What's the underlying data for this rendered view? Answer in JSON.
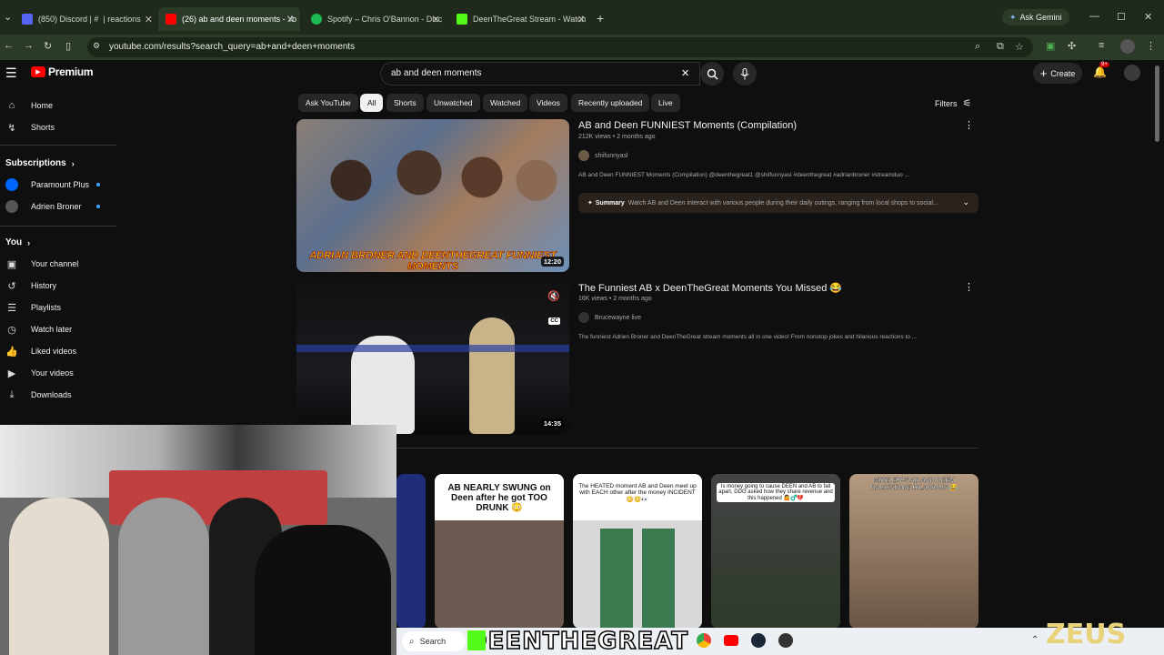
{
  "browser": {
    "tabs": [
      {
        "label": "(850) Discord | # ​ | reactions",
        "color": "#5865f2"
      },
      {
        "label": "(26) ab and deen moments - Yo",
        "color": "#ff0000"
      },
      {
        "label": "Spotify – Chris O'Bannon - Disc",
        "color": "#1db954"
      },
      {
        "label": "DeenTheGreat Stream - Watch",
        "color": "#53fc18"
      }
    ],
    "ask_gemini": "Ask Gemini",
    "url": "youtube.com/results?search_query=ab+and+deen+moments"
  },
  "masthead": {
    "logo": "Premium",
    "search_value": "ab and deen moments",
    "create_label": "Create",
    "notif_count": "9+"
  },
  "sidebar": {
    "top": [
      {
        "label": "Home",
        "icon": "home-icon"
      },
      {
        "label": "Shorts",
        "icon": "shorts-icon"
      }
    ],
    "subs_title": "Subscriptions",
    "subs": [
      {
        "label": "Paramount Plus"
      },
      {
        "label": "Adrien Broner"
      }
    ],
    "you_title": "You",
    "you": [
      {
        "label": "Your channel",
        "icon": "channel-icon"
      },
      {
        "label": "History",
        "icon": "history-icon"
      },
      {
        "label": "Playlists",
        "icon": "playlists-icon"
      },
      {
        "label": "Watch later",
        "icon": "clock-icon"
      },
      {
        "label": "Liked videos",
        "icon": "thumbs-up-icon"
      },
      {
        "label": "Your videos",
        "icon": "video-icon"
      },
      {
        "label": "Downloads",
        "icon": "download-icon"
      }
    ]
  },
  "chips": [
    "Ask YouTube",
    "All",
    "Shorts",
    "Unwatched",
    "Watched",
    "Videos",
    "Recently uploaded",
    "Live"
  ],
  "filters_label": "Filters",
  "results": [
    {
      "title": "AB and Deen FUNNIEST Moments (Compilation)",
      "meta": "212K views • 2 months ago",
      "channel": "shiifunnyasl",
      "desc": "AB and Deen FUNNIEST Moments (Compilation) @deenthegreat1 @shiifunnyasl #deenthegreat #adrianbroner #streamduo ...",
      "summary_label": "Summary",
      "summary": "Watch AB and Deen interact with various people during their daily outings, ranging from local shops to social...",
      "duration": "12:20",
      "thumb_caption": "ADRIAN BRONER AND DEENTHEGREAT FUNNIEST MOMENTS"
    },
    {
      "title": "The Funniest AB x DeenTheGreat Moments You Missed 😂",
      "meta": "16K views • 2 months ago",
      "channel": "Brucewayne live",
      "desc": "The funniest Adrien Broner and DeenTheGreat stream moments all in one video! From nonstop jokes and hilarious reactions to ...",
      "duration": "14:35",
      "cc": "CC"
    }
  ],
  "shorts": [
    {
      "text": "AB NEARLY SWUNG on Deen after he got TOO DRUNK 😳"
    },
    {
      "text": "The HEATED moment AB and Deen meet up with EACH other after the money INCIDENT 😳😳👀"
    },
    {
      "text": "Is money going to cause DEEN and AB to fall apart, DDG asked how they share revenue and this happened 🤷♂️💔"
    },
    {
      "text": "MIKE EPPS AB AND DEEN BACKSTAGE HILARIOUS 😂"
    }
  ],
  "taskbar": {
    "search": "Search"
  },
  "overlay": {
    "deen": "DEENTHEGREAT",
    "zeus": "ZEUS"
  }
}
